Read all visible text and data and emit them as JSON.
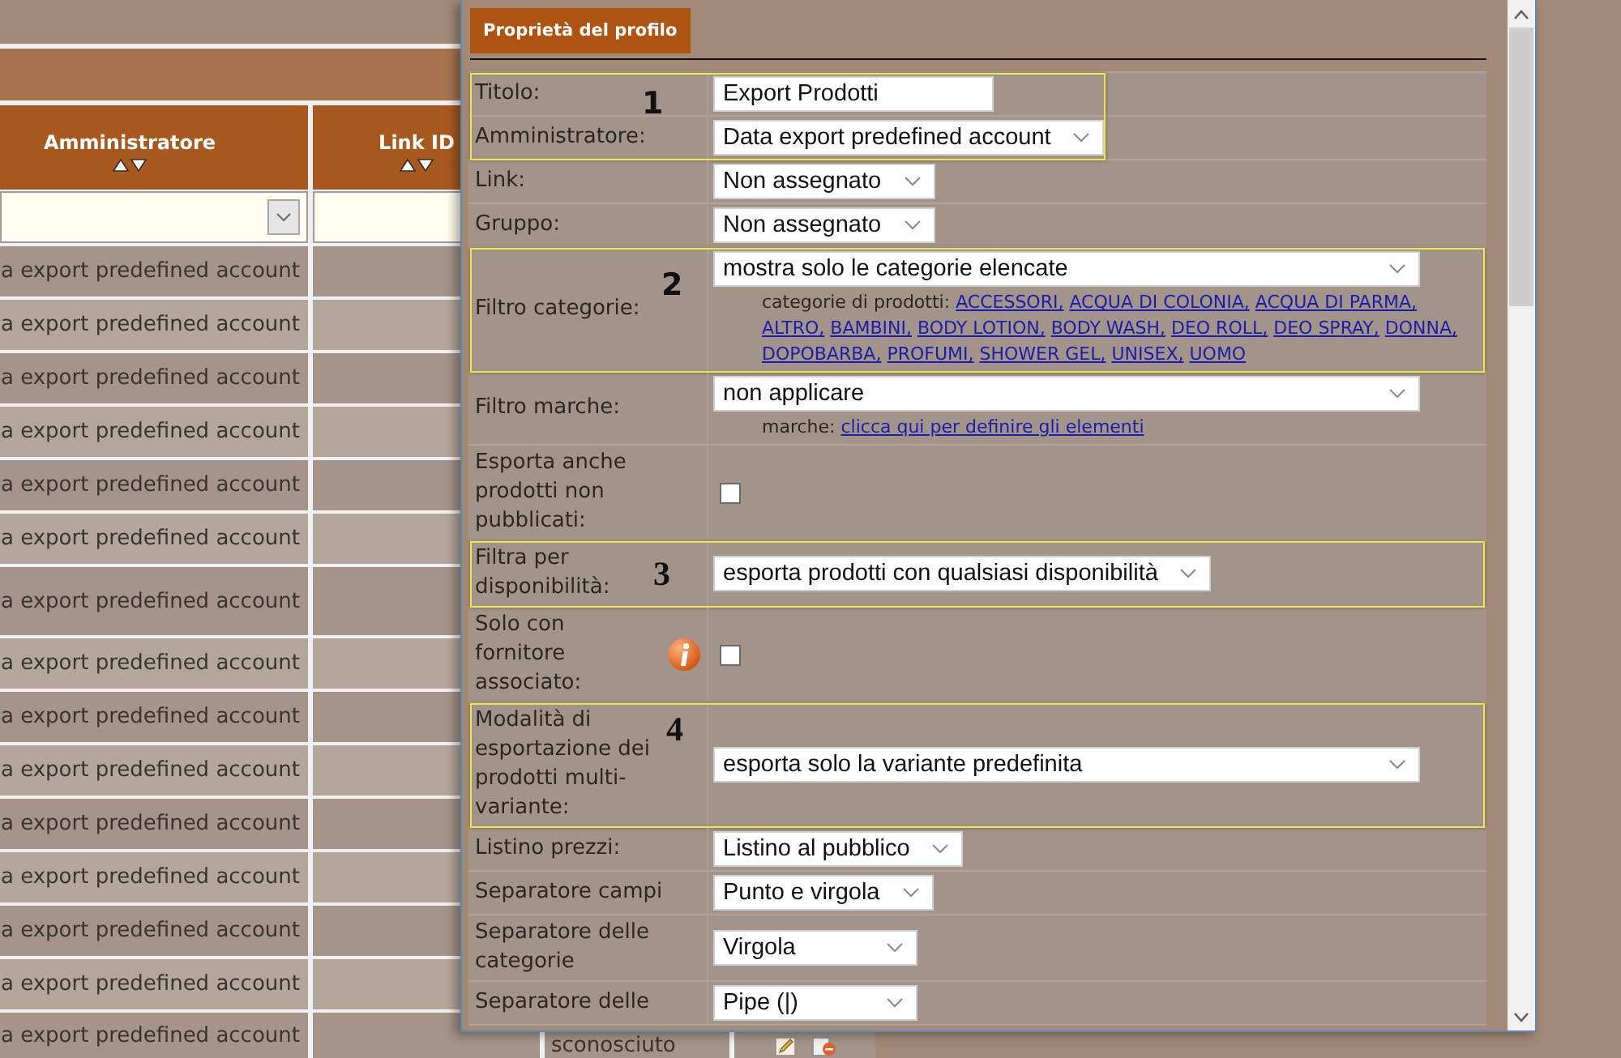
{
  "table": {
    "columns": [
      {
        "label": "Amministratore",
        "sortable": true
      },
      {
        "label": "Link ID",
        "sortable": true
      }
    ],
    "filters": [
      {
        "kind": "select"
      },
      {
        "kind": "input"
      }
    ],
    "rows": [
      {
        "amministratore": "a export predefined account"
      },
      {
        "amministratore": "a export predefined account"
      },
      {
        "amministratore": "a export predefined account"
      },
      {
        "amministratore": "a export predefined account"
      },
      {
        "amministratore": "a export predefined account"
      },
      {
        "amministratore": "a export predefined account"
      },
      {
        "amministratore": "a export predefined account"
      },
      {
        "amministratore": "a export predefined account"
      },
      {
        "amministratore": "a export predefined account"
      },
      {
        "amministratore": "a export predefined account"
      },
      {
        "amministratore": "a export predefined account"
      },
      {
        "amministratore": "a export predefined account"
      },
      {
        "amministratore": "a export predefined account"
      },
      {
        "amministratore": "a export predefined account"
      },
      {
        "amministratore": "a export predefined account",
        "column_3": "sconosciuto"
      }
    ]
  },
  "dialog": {
    "title": "Proprietà del profilo",
    "form": {
      "sections": [
        {
          "callout": "1",
          "rows": [
            {
              "label": "Titolo:",
              "kind": "input",
              "value": "Export Prodotti"
            },
            {
              "label": "Amministratore:",
              "kind": "select",
              "value": "Data export predefined account"
            }
          ]
        },
        {
          "rows": [
            {
              "label": "Link:",
              "kind": "select",
              "value": "Non assegnato"
            },
            {
              "label": "Gruppo:",
              "kind": "select",
              "value": "Non assegnato"
            }
          ]
        },
        {
          "callout": "2",
          "rows": [
            {
              "label": "Filtro categorie:",
              "kind": "select",
              "value": "mostra solo le categorie elencate",
              "note": {
                "prefix": "categorie di prodotti:",
                "links": [
                  "ACCESSORI,",
                  "ACQUA DI COLONIA,",
                  "ACQUA DI PARMA,",
                  "ALTRO,",
                  "BAMBINI,",
                  "BODY LOTION,",
                  "BODY WASH,",
                  "DEO ROLL,",
                  "DEO SPRAY,",
                  "DONNA,",
                  "DOPOBARBA,",
                  "PROFUMI,",
                  "SHOWER GEL,",
                  "UNISEX,",
                  "UOMO"
                ]
              }
            }
          ]
        },
        {
          "rows": [
            {
              "label": "Filtro marche:",
              "kind": "select",
              "value": "non applicare",
              "note": {
                "prefix": "marche:",
                "links": [
                  "clicca qui per definire gli elementi"
                ]
              }
            },
            {
              "label": "Esporta anche prodotti non pubblicati:",
              "kind": "checkbox",
              "checked": false
            }
          ]
        },
        {
          "callout": "3",
          "rows": [
            {
              "label": "Filtra per disponibilità:",
              "kind": "select",
              "value": "esporta prodotti con qualsiasi disponibilità"
            }
          ]
        },
        {
          "rows": [
            {
              "label": "Solo con fornitore associato:",
              "kind": "checkbox",
              "checked": false,
              "info": true
            }
          ]
        },
        {
          "callout": "4",
          "rows": [
            {
              "label": "Modalità di esportazione dei prodotti multi-variante:",
              "kind": "select",
              "value": "esporta solo la variante predefinita"
            }
          ]
        },
        {
          "rows": [
            {
              "label": "Listino prezzi:",
              "kind": "select",
              "value": "Listino al pubblico"
            },
            {
              "label": "Separatore campi",
              "kind": "select",
              "value": "Punto e virgola"
            },
            {
              "label": "Separatore delle categorie",
              "kind": "select",
              "value": "Virgola"
            },
            {
              "label": "Separatore delle",
              "kind": "select",
              "value": "Pipe (|)"
            }
          ]
        }
      ]
    }
  }
}
